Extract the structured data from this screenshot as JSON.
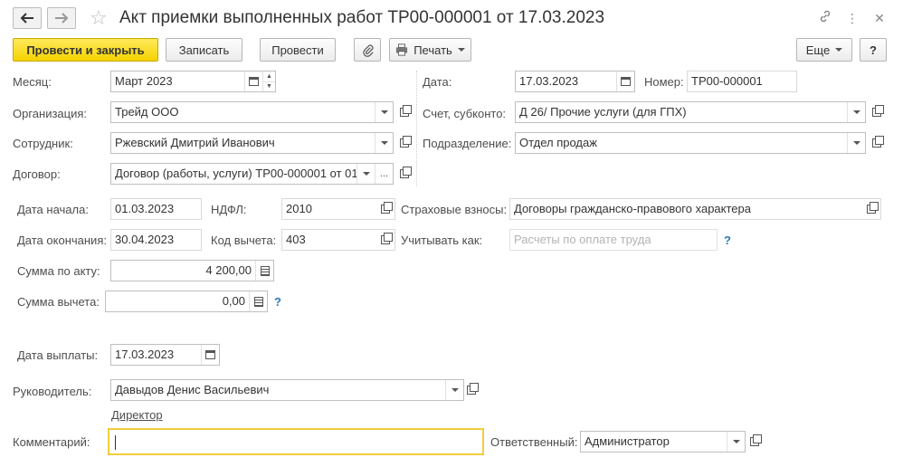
{
  "window": {
    "title": "Акт приемки выполненных работ ТР00-000001 от 17.03.2023"
  },
  "toolbar": {
    "post_close": "Провести и закрыть",
    "save": "Записать",
    "post": "Провести",
    "print": "Печать",
    "more": "Еще",
    "help": "?"
  },
  "form": {
    "month": {
      "label": "Месяц:",
      "value": "Март 2023"
    },
    "date": {
      "label": "Дата:",
      "value": "17.03.2023"
    },
    "number": {
      "label": "Номер:",
      "value": "ТР00-000001"
    },
    "organization": {
      "label": "Организация:",
      "value": "Трейд ООО"
    },
    "account": {
      "label": "Счет, субконто:",
      "value": "Д 26/ Прочие услуги (для ГПХ)"
    },
    "employee": {
      "label": "Сотрудник:",
      "value": "Ржевский Дмитрий Иванович"
    },
    "department": {
      "label": "Подразделение:",
      "value": "Отдел продаж"
    },
    "contract": {
      "label": "Договор:",
      "value": "Договор (работы, услуги) ТР00-000001 от 01"
    },
    "start_date": {
      "label": "Дата начала:",
      "value": "01.03.2023"
    },
    "ndfl": {
      "label": "НДФЛ:",
      "value": "2010"
    },
    "insurance": {
      "label": "Страховые взносы:",
      "value": "Договоры гражданско-правового характера"
    },
    "end_date": {
      "label": "Дата окончания:",
      "value": "30.04.2023"
    },
    "deduction_code": {
      "label": "Код вычета:",
      "value": "403"
    },
    "consider_as": {
      "label": "Учитывать как:",
      "placeholder": "Расчеты по оплате труда"
    },
    "act_sum": {
      "label": "Сумма по акту:",
      "value": "4 200,00"
    },
    "deduction_sum": {
      "label": "Сумма вычета:",
      "value": "0,00"
    },
    "payment_date": {
      "label": "Дата выплаты:",
      "value": "17.03.2023"
    },
    "manager": {
      "label": "Руководитель:",
      "value": "Давыдов Денис Васильевич",
      "position_link": "Директор"
    },
    "comment": {
      "label": "Комментарий:",
      "value": ""
    },
    "responsible": {
      "label": "Ответственный:",
      "value": "Администратор"
    }
  },
  "help_mark": "?"
}
